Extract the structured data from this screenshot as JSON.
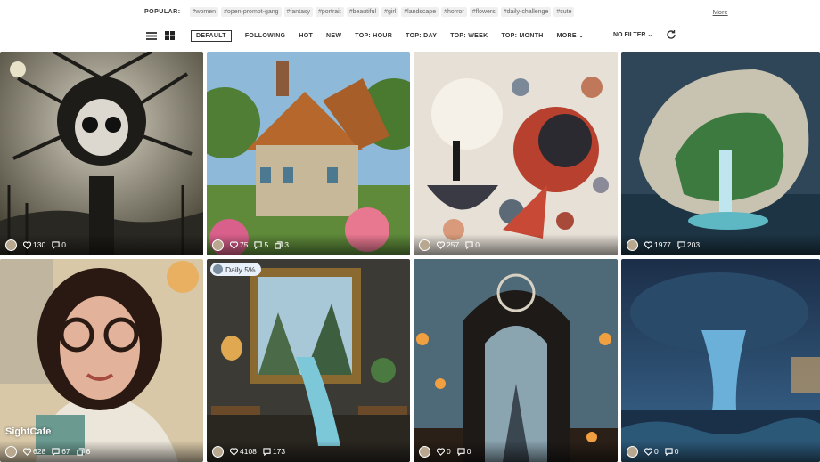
{
  "popular": {
    "label": "POPULAR:",
    "tags": [
      "#women",
      "#open-prompt-gang",
      "#fantasy",
      "#portrait",
      "#beautiful",
      "#girl",
      "#landscape",
      "#horror",
      "#flowers",
      "#daily-challenge",
      "#cute"
    ],
    "more": "More"
  },
  "toolbar": {
    "tabs": [
      "DEFAULT",
      "FOLLOWING",
      "HOT",
      "NEW",
      "TOP: HOUR",
      "TOP: DAY",
      "TOP: WEEK",
      "TOP: MONTH",
      "MORE"
    ],
    "active_tab": "DEFAULT",
    "filter": "NO FILTER"
  },
  "cards": [
    {
      "likes": "130",
      "comments": "0"
    },
    {
      "likes": "75",
      "comments": "5",
      "remixes": "3"
    },
    {
      "likes": "257",
      "comments": "0"
    },
    {
      "likes": "1977",
      "comments": "203"
    },
    {
      "likes": "628",
      "comments": "67",
      "remixes": "6",
      "watermark": "SightCafe"
    },
    {
      "likes": "4108",
      "comments": "173",
      "badge": "Daily 5%"
    },
    {
      "likes": "0",
      "comments": "0"
    },
    {
      "likes": "0",
      "comments": "0"
    }
  ],
  "icons": {
    "heart": "heart-icon",
    "comment": "comment-icon",
    "remix": "image-stack-icon",
    "list_view": "list-view-icon",
    "grid_view": "grid-view-icon",
    "refresh": "refresh-icon",
    "chevron": "chevron-down-icon"
  }
}
